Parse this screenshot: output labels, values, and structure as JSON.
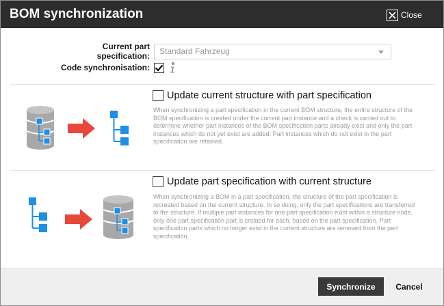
{
  "dialog": {
    "title": "BOM synchronization",
    "close_label": "Close"
  },
  "form": {
    "part_spec_label": "Current part specification:",
    "part_spec_value": "Standard Fahrzeug",
    "code_sync_label": "Code synchronisation:",
    "code_sync_checked": true
  },
  "options": [
    {
      "title": "Update current structure with part specification",
      "checked": false,
      "description": "When synchronizing a part specification in the current BOM structure, the entire structure of the BOM specification is created under the current part instance and a check is carried out to determine whether part instances of the BOM specification parts already exist and only the part instances which do not yet exist are added. Part instances which do not exist in the part specification are retained."
    },
    {
      "title": "Update part specification with current structure",
      "checked": false,
      "description": "When synchronizing a BOM in a part specification, the structure of the part specification is recreated based on the current structure. In so doing, only the part specifications are transferred to the structure. If multiple part instances for one part specification exist within a structure node, only one part specification part is created for each, based on the part specification. Part specification parts which no longer exist in the current structure are removed from the part specification."
    }
  ],
  "footer": {
    "synchronize_label": "Synchronize",
    "cancel_label": "Cancel"
  },
  "colors": {
    "titlebar": "#2d2d2d",
    "structure_blue": "#1e8fe6",
    "arrow_red": "#e8473b",
    "database_gray": "#a8a8a8"
  },
  "icons": [
    "close-icon",
    "info-icon",
    "database-icon",
    "structure-tree-icon",
    "arrow-right-icon"
  ]
}
